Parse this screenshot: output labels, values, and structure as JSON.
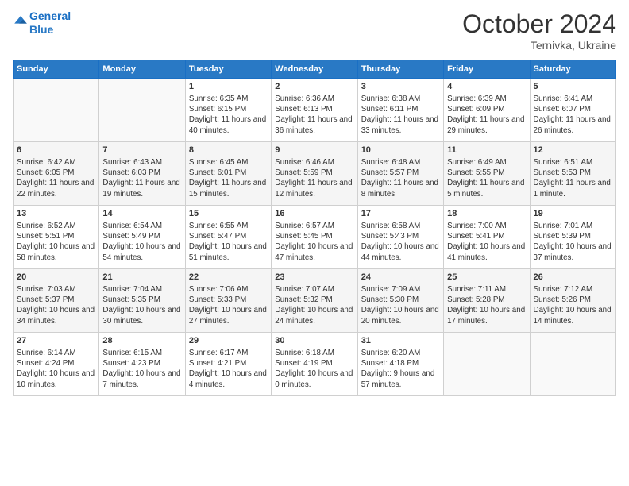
{
  "header": {
    "logo_line1": "General",
    "logo_line2": "Blue",
    "month": "October 2024",
    "location": "Ternivka, Ukraine"
  },
  "weekdays": [
    "Sunday",
    "Monday",
    "Tuesday",
    "Wednesday",
    "Thursday",
    "Friday",
    "Saturday"
  ],
  "weeks": [
    [
      {
        "day": "",
        "data": ""
      },
      {
        "day": "",
        "data": ""
      },
      {
        "day": "1",
        "data": "Sunrise: 6:35 AM\nSunset: 6:15 PM\nDaylight: 11 hours and 40 minutes."
      },
      {
        "day": "2",
        "data": "Sunrise: 6:36 AM\nSunset: 6:13 PM\nDaylight: 11 hours and 36 minutes."
      },
      {
        "day": "3",
        "data": "Sunrise: 6:38 AM\nSunset: 6:11 PM\nDaylight: 11 hours and 33 minutes."
      },
      {
        "day": "4",
        "data": "Sunrise: 6:39 AM\nSunset: 6:09 PM\nDaylight: 11 hours and 29 minutes."
      },
      {
        "day": "5",
        "data": "Sunrise: 6:41 AM\nSunset: 6:07 PM\nDaylight: 11 hours and 26 minutes."
      }
    ],
    [
      {
        "day": "6",
        "data": "Sunrise: 6:42 AM\nSunset: 6:05 PM\nDaylight: 11 hours and 22 minutes."
      },
      {
        "day": "7",
        "data": "Sunrise: 6:43 AM\nSunset: 6:03 PM\nDaylight: 11 hours and 19 minutes."
      },
      {
        "day": "8",
        "data": "Sunrise: 6:45 AM\nSunset: 6:01 PM\nDaylight: 11 hours and 15 minutes."
      },
      {
        "day": "9",
        "data": "Sunrise: 6:46 AM\nSunset: 5:59 PM\nDaylight: 11 hours and 12 minutes."
      },
      {
        "day": "10",
        "data": "Sunrise: 6:48 AM\nSunset: 5:57 PM\nDaylight: 11 hours and 8 minutes."
      },
      {
        "day": "11",
        "data": "Sunrise: 6:49 AM\nSunset: 5:55 PM\nDaylight: 11 hours and 5 minutes."
      },
      {
        "day": "12",
        "data": "Sunrise: 6:51 AM\nSunset: 5:53 PM\nDaylight: 11 hours and 1 minute."
      }
    ],
    [
      {
        "day": "13",
        "data": "Sunrise: 6:52 AM\nSunset: 5:51 PM\nDaylight: 10 hours and 58 minutes."
      },
      {
        "day": "14",
        "data": "Sunrise: 6:54 AM\nSunset: 5:49 PM\nDaylight: 10 hours and 54 minutes."
      },
      {
        "day": "15",
        "data": "Sunrise: 6:55 AM\nSunset: 5:47 PM\nDaylight: 10 hours and 51 minutes."
      },
      {
        "day": "16",
        "data": "Sunrise: 6:57 AM\nSunset: 5:45 PM\nDaylight: 10 hours and 47 minutes."
      },
      {
        "day": "17",
        "data": "Sunrise: 6:58 AM\nSunset: 5:43 PM\nDaylight: 10 hours and 44 minutes."
      },
      {
        "day": "18",
        "data": "Sunrise: 7:00 AM\nSunset: 5:41 PM\nDaylight: 10 hours and 41 minutes."
      },
      {
        "day": "19",
        "data": "Sunrise: 7:01 AM\nSunset: 5:39 PM\nDaylight: 10 hours and 37 minutes."
      }
    ],
    [
      {
        "day": "20",
        "data": "Sunrise: 7:03 AM\nSunset: 5:37 PM\nDaylight: 10 hours and 34 minutes."
      },
      {
        "day": "21",
        "data": "Sunrise: 7:04 AM\nSunset: 5:35 PM\nDaylight: 10 hours and 30 minutes."
      },
      {
        "day": "22",
        "data": "Sunrise: 7:06 AM\nSunset: 5:33 PM\nDaylight: 10 hours and 27 minutes."
      },
      {
        "day": "23",
        "data": "Sunrise: 7:07 AM\nSunset: 5:32 PM\nDaylight: 10 hours and 24 minutes."
      },
      {
        "day": "24",
        "data": "Sunrise: 7:09 AM\nSunset: 5:30 PM\nDaylight: 10 hours and 20 minutes."
      },
      {
        "day": "25",
        "data": "Sunrise: 7:11 AM\nSunset: 5:28 PM\nDaylight: 10 hours and 17 minutes."
      },
      {
        "day": "26",
        "data": "Sunrise: 7:12 AM\nSunset: 5:26 PM\nDaylight: 10 hours and 14 minutes."
      }
    ],
    [
      {
        "day": "27",
        "data": "Sunrise: 6:14 AM\nSunset: 4:24 PM\nDaylight: 10 hours and 10 minutes."
      },
      {
        "day": "28",
        "data": "Sunrise: 6:15 AM\nSunset: 4:23 PM\nDaylight: 10 hours and 7 minutes."
      },
      {
        "day": "29",
        "data": "Sunrise: 6:17 AM\nSunset: 4:21 PM\nDaylight: 10 hours and 4 minutes."
      },
      {
        "day": "30",
        "data": "Sunrise: 6:18 AM\nSunset: 4:19 PM\nDaylight: 10 hours and 0 minutes."
      },
      {
        "day": "31",
        "data": "Sunrise: 6:20 AM\nSunset: 4:18 PM\nDaylight: 9 hours and 57 minutes."
      },
      {
        "day": "",
        "data": ""
      },
      {
        "day": "",
        "data": ""
      }
    ]
  ]
}
